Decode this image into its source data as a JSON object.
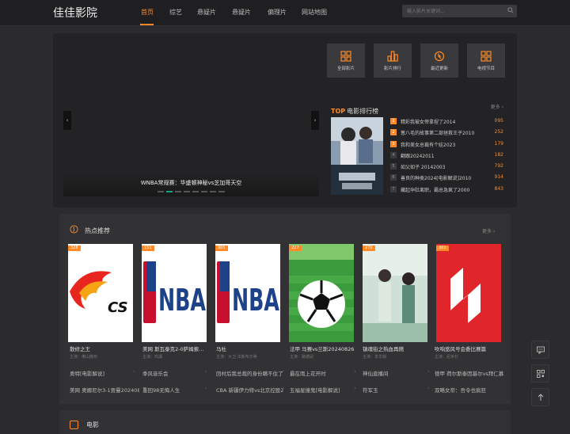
{
  "header": {
    "logo": "佳佳影院",
    "nav": [
      {
        "label": "首页",
        "active": true
      },
      {
        "label": "综艺"
      },
      {
        "label": "悬疑片"
      },
      {
        "label": "悬疑片"
      },
      {
        "label": "偏理片"
      },
      {
        "label": "网站地图"
      }
    ],
    "search": {
      "placeholder": "输入影片关键词..."
    }
  },
  "banner": {
    "caption": "WNBA常规赛：华盛顿神秘vs芝加哥天空",
    "prev": "‹",
    "next": "›",
    "dot_count": 8,
    "active_dot": 1
  },
  "quick": [
    {
      "label": "全部影片",
      "icon": "grid-icon"
    },
    {
      "label": "影片排行",
      "icon": "bar-chart-icon"
    },
    {
      "label": "最近更新",
      "icon": "refresh-icon"
    },
    {
      "label": "电视节目",
      "icon": "tv-grid-icon"
    }
  ],
  "ranking": {
    "tag": "TOP",
    "title": "电影排行榜",
    "more": "更多",
    "items": [
      {
        "no": "1",
        "title": "精彩我被女帝拿捏了2014",
        "score": "095"
      },
      {
        "no": "2",
        "title": "葱八毛的故事第二部拯救王子2010",
        "score": "252"
      },
      {
        "no": "3",
        "title": "我和美女总裁有个娃2023",
        "score": "179"
      },
      {
        "no": "4",
        "title": "翻跟20242011",
        "score": "182"
      },
      {
        "no": "5",
        "title": "如父如子 20142003",
        "score": "792"
      },
      {
        "no": "6",
        "title": "善良的种类2024[电影解说]2010",
        "score": "914"
      },
      {
        "no": "7",
        "title": "藏起孕肚离职，霸总急疯了2000",
        "score": "843"
      }
    ]
  },
  "hot": {
    "title": "热点推荐",
    "more": "更多",
    "cards": [
      {
        "badge": "328",
        "title": "散修之王",
        "sub": "主演：佛山散布"
      },
      {
        "badge": "151",
        "title": "美网 斯瓦泰克2-0萨姆索...",
        "sub": "主演：鸡湖"
      },
      {
        "badge": "905",
        "title": "马杜",
        "sub": "主演：大卫·法斯布尔等"
      },
      {
        "badge": "227",
        "title": "法甲 马赛vs兰斯20240826",
        "sub": "主演：路德武"
      },
      {
        "badge": "270",
        "title": "镇魂街之热血再燃",
        "sub": "主演：袁华娟"
      },
      {
        "badge": "301",
        "title": "吹响悠风号会委比赛篇",
        "sub": "主演：尼禾杉"
      }
    ],
    "links": [
      [
        "奥特[电影解说]",
        "季风音乐会",
        "回村后我总裁的身份瞒不住了",
        "最在雨上花开时",
        "神仙直播间",
        "德甲 荷尔斯泰因基尔vs拜仁慕"
      ],
      [
        "美网 奥娜尼尔3-1贾曼202408",
        "重回98无悔人生",
        "CBA 新疆伊力特vs北京控股2",
        "五福星撞鬼[电影解说]",
        "符军玉",
        "双略女帝：吾令也疯狂"
      ]
    ]
  },
  "movies": {
    "title": "电影"
  }
}
